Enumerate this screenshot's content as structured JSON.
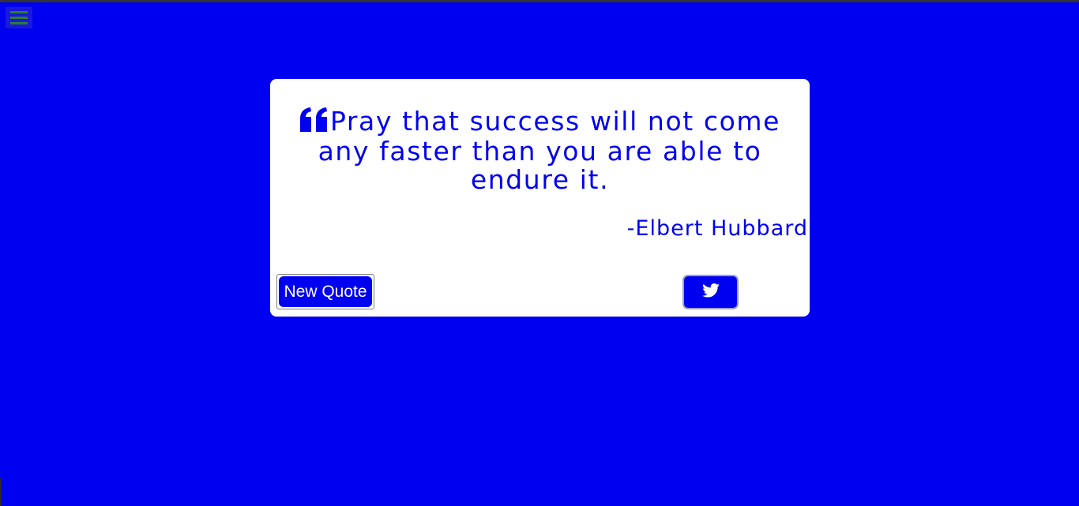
{
  "nav": {
    "menu_icon": "hamburger-icon",
    "menu_bar_color": "#2e7d32"
  },
  "quote": {
    "icon": "quote-left-icon",
    "text": "Pray that success will not come any faster than you are able to endure it.",
    "author": "-Elbert Hubbard"
  },
  "actions": {
    "new_quote_label": "New Quote",
    "tweet_icon": "twitter-icon"
  },
  "colors": {
    "background": "#0000f0",
    "card": "#ffffff",
    "accent": "#0000f0"
  }
}
